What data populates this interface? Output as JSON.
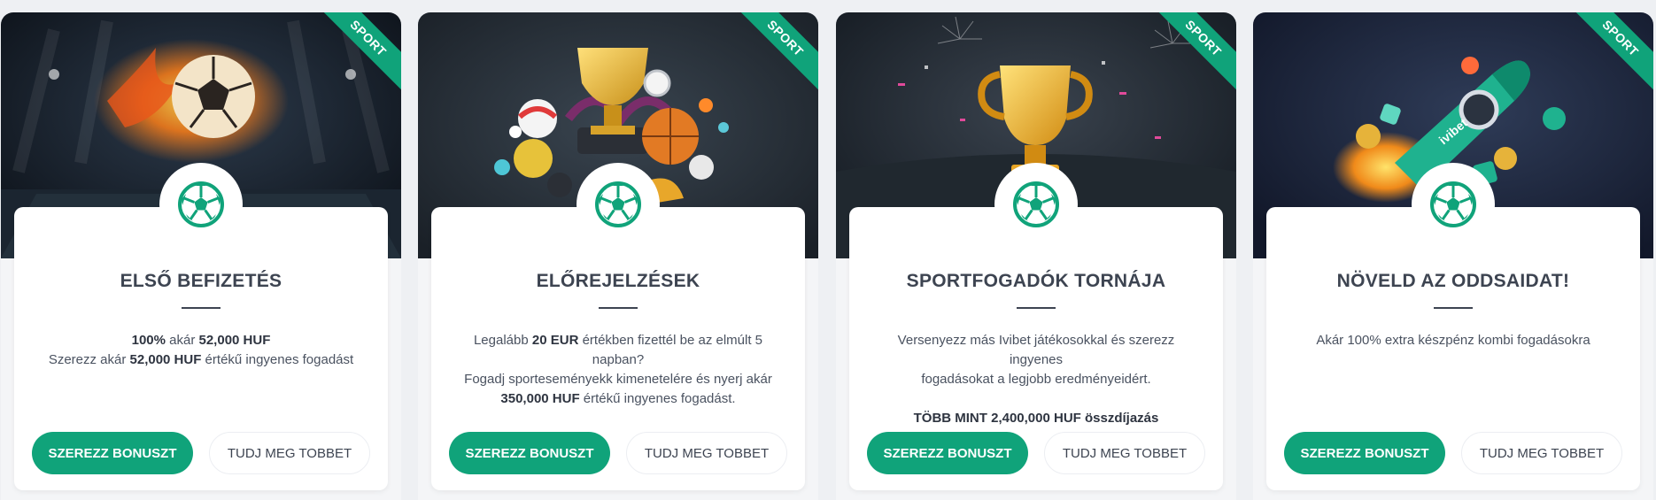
{
  "cards": [
    {
      "ribbon": "SPORT",
      "title": "ELSŐ BEFIZETÉS",
      "line1_b1": "100%",
      "line1_t1": " akár ",
      "line1_b2": "52,000 HUF",
      "line2_t1": "Szerezz akár ",
      "line2_b1": "52,000 HUF",
      "line2_t2": " értékű ingyenes fogadást",
      "primary": "SZEREZZ BONUSZT",
      "secondary": "TUDJ MEG TOBBET",
      "hero_icon": "flaming-soccer-ball-icon",
      "badge_icon": "soccer-ball-icon"
    },
    {
      "ribbon": "SPORT",
      "title": "ELŐREJELZÉSEK",
      "line1_t1": "Legalább ",
      "line1_b1": "20 EUR",
      "line1_t2": " értékben fizettél be az elmúlt 5",
      "line2_t1": "napban?",
      "line3_t1": "Fogadj sporteseményekk kimenetelére és nyerj akár",
      "line4_b1": "350,000 HUF",
      "line4_t1": " értékű ingyenes fogadást.",
      "primary": "SZEREZZ BONUSZT",
      "secondary": "TUDJ MEG TOBBET",
      "hero_icon": "trophy-and-balls-icon",
      "badge_icon": "soccer-ball-icon"
    },
    {
      "ribbon": "SPORT",
      "title": "SPORTFOGADÓK TORNÁJA",
      "line1_t1": "Versenyezz más Ivibet játékosokkal és szerezz ingyenes",
      "line2_t1": "fogadásokat a legjobb eredményeidért.",
      "line3_b1": "TÖBB MINT 2,400,000 HUF összdíjazás",
      "primary": "SZEREZZ BONUSZT",
      "secondary": "TUDJ MEG TOBBET",
      "hero_icon": "gold-trophy-icon",
      "badge_icon": "soccer-ball-icon"
    },
    {
      "ribbon": "SPORT",
      "title": "NÖVELD AZ ODDSAIDAT!",
      "line1_t1": "Akár 100% extra készpénz kombi fogadásokra",
      "primary": "SZEREZZ BONUSZT",
      "secondary": "TUDJ MEG TOBBET",
      "hero_icon": "rocket-icon",
      "rocket_text": "ivibet",
      "badge_icon": "soccer-ball-icon"
    }
  ],
  "colors": {
    "accent": "#10a37a",
    "text": "#3d4451"
  }
}
